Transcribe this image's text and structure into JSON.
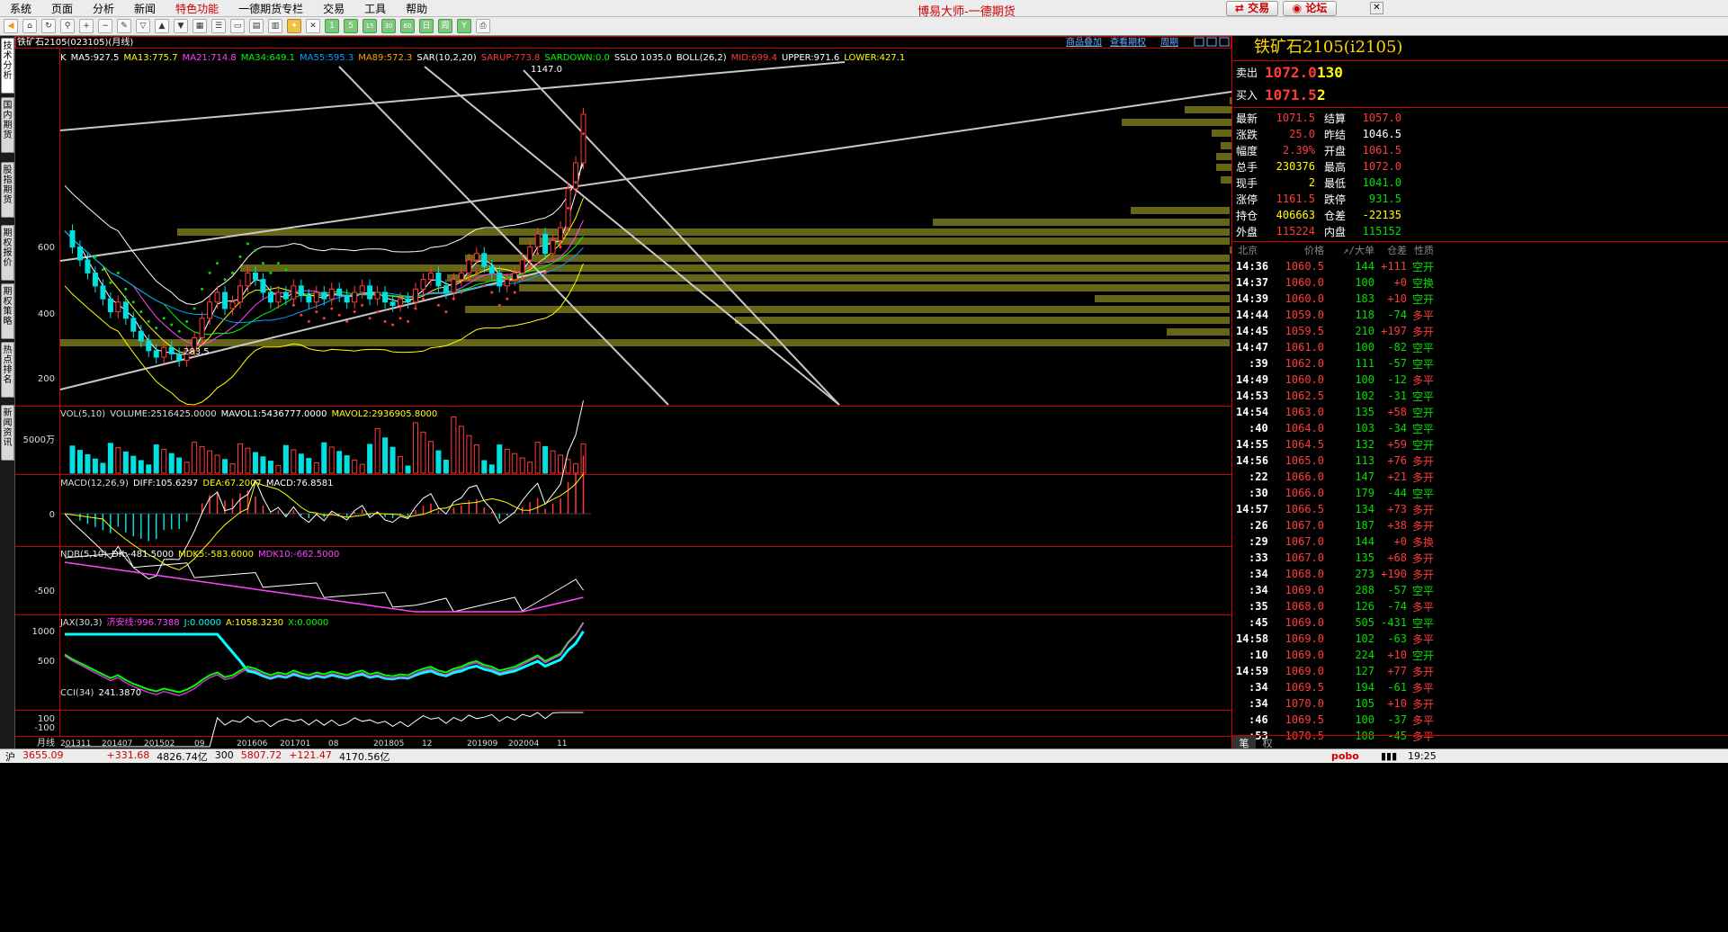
{
  "menu": [
    "系统",
    "页面",
    "分析",
    "新闻",
    "特色功能",
    "一德期货专栏",
    "交易",
    "工具",
    "帮助"
  ],
  "app_title": "博易大师-一德期货",
  "top_buttons": {
    "trade": "交易",
    "forum": "论坛"
  },
  "toolbar_labels": [
    "1",
    "5",
    "15",
    "30",
    "60",
    "日",
    "周"
  ],
  "side_tabs": [
    "技术分析",
    "国内期货",
    "股指期货",
    "期权报价",
    "期权策略",
    "热点排名",
    "新闻资讯"
  ],
  "chart_header": {
    "symbol_title": "铁矿石2105(023105)(月线)",
    "links": [
      "商品叠加",
      "查看期权",
      "周期"
    ]
  },
  "indicator_line": [
    {
      "text": "K",
      "color": "#ffffff"
    },
    {
      "text": "MA5:927.5",
      "color": "#ffffff"
    },
    {
      "text": "MA13:775.7",
      "color": "#ffff00"
    },
    {
      "text": "MA21:714.8",
      "color": "#ff44ff"
    },
    {
      "text": "MA34:649.1",
      "color": "#00ff00"
    },
    {
      "text": "MA55:595.3",
      "color": "#00a0ff"
    },
    {
      "text": "MA89:572.3",
      "color": "#ffa000"
    },
    {
      "text": "SAR(10,2,20)",
      "color": "#ffffff"
    },
    {
      "text": "SARUP:773.8",
      "color": "#ff3b3b"
    },
    {
      "text": "SARDOWN:0.0",
      "color": "#00ff00"
    },
    {
      "text": "SSLO 1035.0",
      "color": "#ffffff"
    },
    {
      "text": "BOLL(26,2)",
      "color": "#ffffff"
    },
    {
      "text": "MID:699.4",
      "color": "#ff3b3b"
    },
    {
      "text": "UPPER:971.6",
      "color": "#ffffff"
    },
    {
      "text": "LOWER:427.1",
      "color": "#ffff00"
    }
  ],
  "y_axis_main": [
    "600",
    "400",
    "200"
  ],
  "annotations": {
    "high": "1147.0",
    "low": "283.5"
  },
  "volume_panel": [
    {
      "text": "VOL(5,10)",
      "color": "#dddddd"
    },
    {
      "text": "VOLUME:2516425.0000",
      "color": "#dddddd"
    },
    {
      "text": "MAVOL1:5436777.0000",
      "color": "#ffffff"
    },
    {
      "text": "MAVOL2:2936905.8000",
      "color": "#ffff00"
    }
  ],
  "volume_axis": "5000万",
  "macd_panel": [
    {
      "text": "MACD(12,26,9)",
      "color": "#dddddd"
    },
    {
      "text": "DIFF:105.6297",
      "color": "#ffffff"
    },
    {
      "text": "DEA:67.2007",
      "color": "#ffff00"
    },
    {
      "text": "MACD:76.8581",
      "color": "#ffffff"
    }
  ],
  "macd_axis": "0",
  "ndb_panel": [
    {
      "text": "NDB(5,10)",
      "color": "#dddddd"
    },
    {
      "text": "DK:-481.5000",
      "color": "#ffffff"
    },
    {
      "text": "MDK5:-583.6000",
      "color": "#ffff00"
    },
    {
      "text": "MDK10:-662.5000",
      "color": "#ff44ff"
    }
  ],
  "ndb_axis": "-500",
  "jax_panel": [
    {
      "text": "JAX(30,3)",
      "color": "#dddddd"
    },
    {
      "text": "济安线:996.7388",
      "color": "#ff44ff"
    },
    {
      "text": "J:0.0000",
      "color": "#00ffff"
    },
    {
      "text": "A:1058.3230",
      "color": "#ffff00"
    },
    {
      "text": "X:0.0000",
      "color": "#00ff00"
    }
  ],
  "jax_axis": [
    "1000",
    "500"
  ],
  "cci_panel": [
    {
      "text": "CCI(34)",
      "color": "#dddddd"
    },
    {
      "text": "241.3870",
      "color": "#ffffff"
    }
  ],
  "cci_axis": [
    "100",
    "-100"
  ],
  "x_axis": {
    "period_label": "月线",
    "labels": [
      "201311",
      "201407",
      "201502",
      "09",
      "201606",
      "201701",
      "08",
      "201805",
      "12",
      "201909",
      "202004",
      "11"
    ]
  },
  "quote": {
    "title": "铁矿石2105(i2105)",
    "ask_label": "卖出",
    "ask": "1072.0",
    "ask_vol": "130",
    "bid_label": "买入",
    "bid": "1071.5",
    "bid_vol": "2",
    "rows": [
      [
        "最新",
        "1071.5",
        "red",
        "结算",
        "1057.0",
        "red"
      ],
      [
        "涨跌",
        "25.0",
        "red",
        "昨结",
        "1046.5",
        "wht"
      ],
      [
        "幅度",
        "2.39%",
        "red",
        "开盘",
        "1061.5",
        "red"
      ],
      [
        "总手",
        "230376",
        "yel",
        "最高",
        "1072.0",
        "red"
      ],
      [
        "现手",
        "2",
        "yel",
        "最低",
        "1041.0",
        "grn"
      ],
      [
        "涨停",
        "1161.5",
        "red",
        "跌停",
        "931.5",
        "grn"
      ],
      [
        "持仓",
        "406663",
        "yel",
        "仓差",
        "-22135",
        "yel"
      ],
      [
        "外盘",
        "115224",
        "red",
        "内盘",
        "115152",
        "grn"
      ]
    ]
  },
  "tick_header": [
    "北京",
    "价格",
    "↗/大单",
    "仓差",
    "性质"
  ],
  "ticks": [
    [
      "14:36",
      "1060.5",
      "144",
      "+111",
      "空开"
    ],
    [
      "14:37",
      "1060.0",
      "100",
      "+0",
      "空换"
    ],
    [
      "14:39",
      "1060.0",
      "183",
      "+10",
      "空开"
    ],
    [
      "14:44",
      "1059.0",
      "118",
      "-74",
      "多平"
    ],
    [
      "14:45",
      "1059.5",
      "210",
      "+197",
      "多开"
    ],
    [
      "14:47",
      "1061.0",
      "100",
      "-82",
      "空平"
    ],
    [
      ":39",
      "1062.0",
      "111",
      "-57",
      "空平"
    ],
    [
      "14:49",
      "1060.0",
      "100",
      "-12",
      "多平"
    ],
    [
      "14:53",
      "1062.5",
      "102",
      "-31",
      "空平"
    ],
    [
      "14:54",
      "1063.0",
      "135",
      "+58",
      "空开"
    ],
    [
      ":40",
      "1064.0",
      "103",
      "-34",
      "空平"
    ],
    [
      "14:55",
      "1064.5",
      "132",
      "+59",
      "空开"
    ],
    [
      "14:56",
      "1065.0",
      "113",
      "+76",
      "多开"
    ],
    [
      ":22",
      "1066.0",
      "147",
      "+21",
      "多开"
    ],
    [
      ":30",
      "1066.0",
      "179",
      "-44",
      "空平"
    ],
    [
      "14:57",
      "1066.5",
      "134",
      "+73",
      "多开"
    ],
    [
      ":26",
      "1067.0",
      "187",
      "+38",
      "多开"
    ],
    [
      ":29",
      "1067.0",
      "144",
      "+0",
      "多换"
    ],
    [
      ":33",
      "1067.0",
      "135",
      "+68",
      "多开"
    ],
    [
      ":34",
      "1068.0",
      "273",
      "+190",
      "多开"
    ],
    [
      ":34",
      "1069.0",
      "288",
      "-57",
      "空平"
    ],
    [
      ":35",
      "1068.0",
      "126",
      "-74",
      "多平"
    ],
    [
      ":45",
      "1069.0",
      "505",
      "-431",
      "空平"
    ],
    [
      "14:58",
      "1069.0",
      "102",
      "-63",
      "多平"
    ],
    [
      ":10",
      "1069.0",
      "224",
      "+10",
      "空开"
    ],
    [
      "14:59",
      "1069.0",
      "127",
      "+77",
      "多开"
    ],
    [
      ":34",
      "1069.5",
      "194",
      "-61",
      "多平"
    ],
    [
      ":34",
      "1070.0",
      "105",
      "+10",
      "多开"
    ],
    [
      ":46",
      "1069.5",
      "100",
      "-37",
      "多平"
    ],
    [
      ":53",
      "1070.5",
      "108",
      "-45",
      "多平"
    ]
  ],
  "tick_tabs": [
    "笔",
    "权"
  ],
  "status": [
    {
      "text": "沪",
      "color": "#000"
    },
    {
      "text": "3655.09",
      "color": "#c00"
    },
    {
      "text": "+331.68",
      "color": "#c00"
    },
    {
      "text": "4826.74亿",
      "color": "#000"
    },
    {
      "text": "300",
      "color": "#000"
    },
    {
      "text": "5807.72",
      "color": "#c00"
    },
    {
      "text": "+121.47",
      "color": "#c00"
    },
    {
      "text": "4170.56亿",
      "color": "#000"
    }
  ],
  "status_right": {
    "brand": "pobo",
    "time": "19:25"
  }
}
